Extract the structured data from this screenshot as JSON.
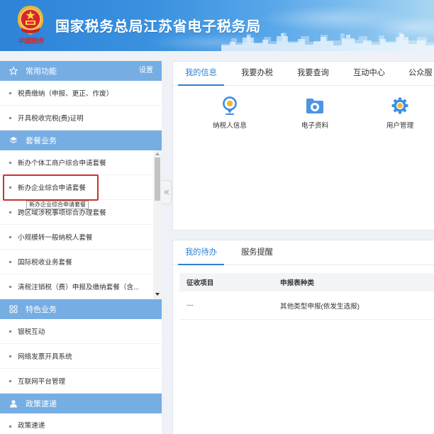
{
  "header": {
    "title": "国家税务总局江苏省电子税务局",
    "logo_caption": "中国税务",
    "emblem_icon": "tax-emblem-icon"
  },
  "sidebar": {
    "common": {
      "title": "常用功能",
      "icon": "star-icon",
      "action_label": "设置",
      "items": [
        "税费缴纳（申报、更正、作废）",
        "开具税收完税(费)证明"
      ]
    },
    "packages": {
      "title": "套餐业务",
      "icon": "layers-icon",
      "items": [
        "新办个体工商户综合申请套餐",
        "新办企业综合申请套餐",
        "跨区域涉税事项综合办理套餐",
        "小规模转一般纳税人套餐",
        "国际税收业务套餐",
        "清税注销税（费）申报及缴纳套餐（含..."
      ],
      "highlighted_index": 1,
      "tooltip": "新办企业综合申请套餐"
    },
    "featured": {
      "title": "特色业务",
      "icon": "grid-icon",
      "items": [
        "银税互动",
        "网络发票开具系统",
        "互联网平台管理"
      ]
    },
    "policy": {
      "title": "政策速递",
      "icon": "user-icon",
      "items": [
        "政策速递"
      ]
    },
    "collapse_icon": "double-chevron-left-icon"
  },
  "info_panel": {
    "tabs": [
      "我的信息",
      "我要办税",
      "我要查询",
      "互动中心",
      "公众服"
    ],
    "active_tab_index": 0,
    "shortcuts": [
      {
        "label": "纳税人信息",
        "icon": "taxpayer-info-icon"
      },
      {
        "label": "电子资料",
        "icon": "folder-icon"
      },
      {
        "label": "用户管理",
        "icon": "gear-icon"
      }
    ]
  },
  "todo_panel": {
    "tabs": [
      "我的待办",
      "服务提醒"
    ],
    "active_tab_index": 0,
    "columns": [
      "征收项目",
      "申报表种类"
    ],
    "rows": [
      [
        "---",
        "其他类型申报(依发生选报)"
      ]
    ]
  },
  "colors": {
    "section_header": "#76aee4",
    "accent": "#2d80d2",
    "highlight_border": "#c8332d"
  }
}
